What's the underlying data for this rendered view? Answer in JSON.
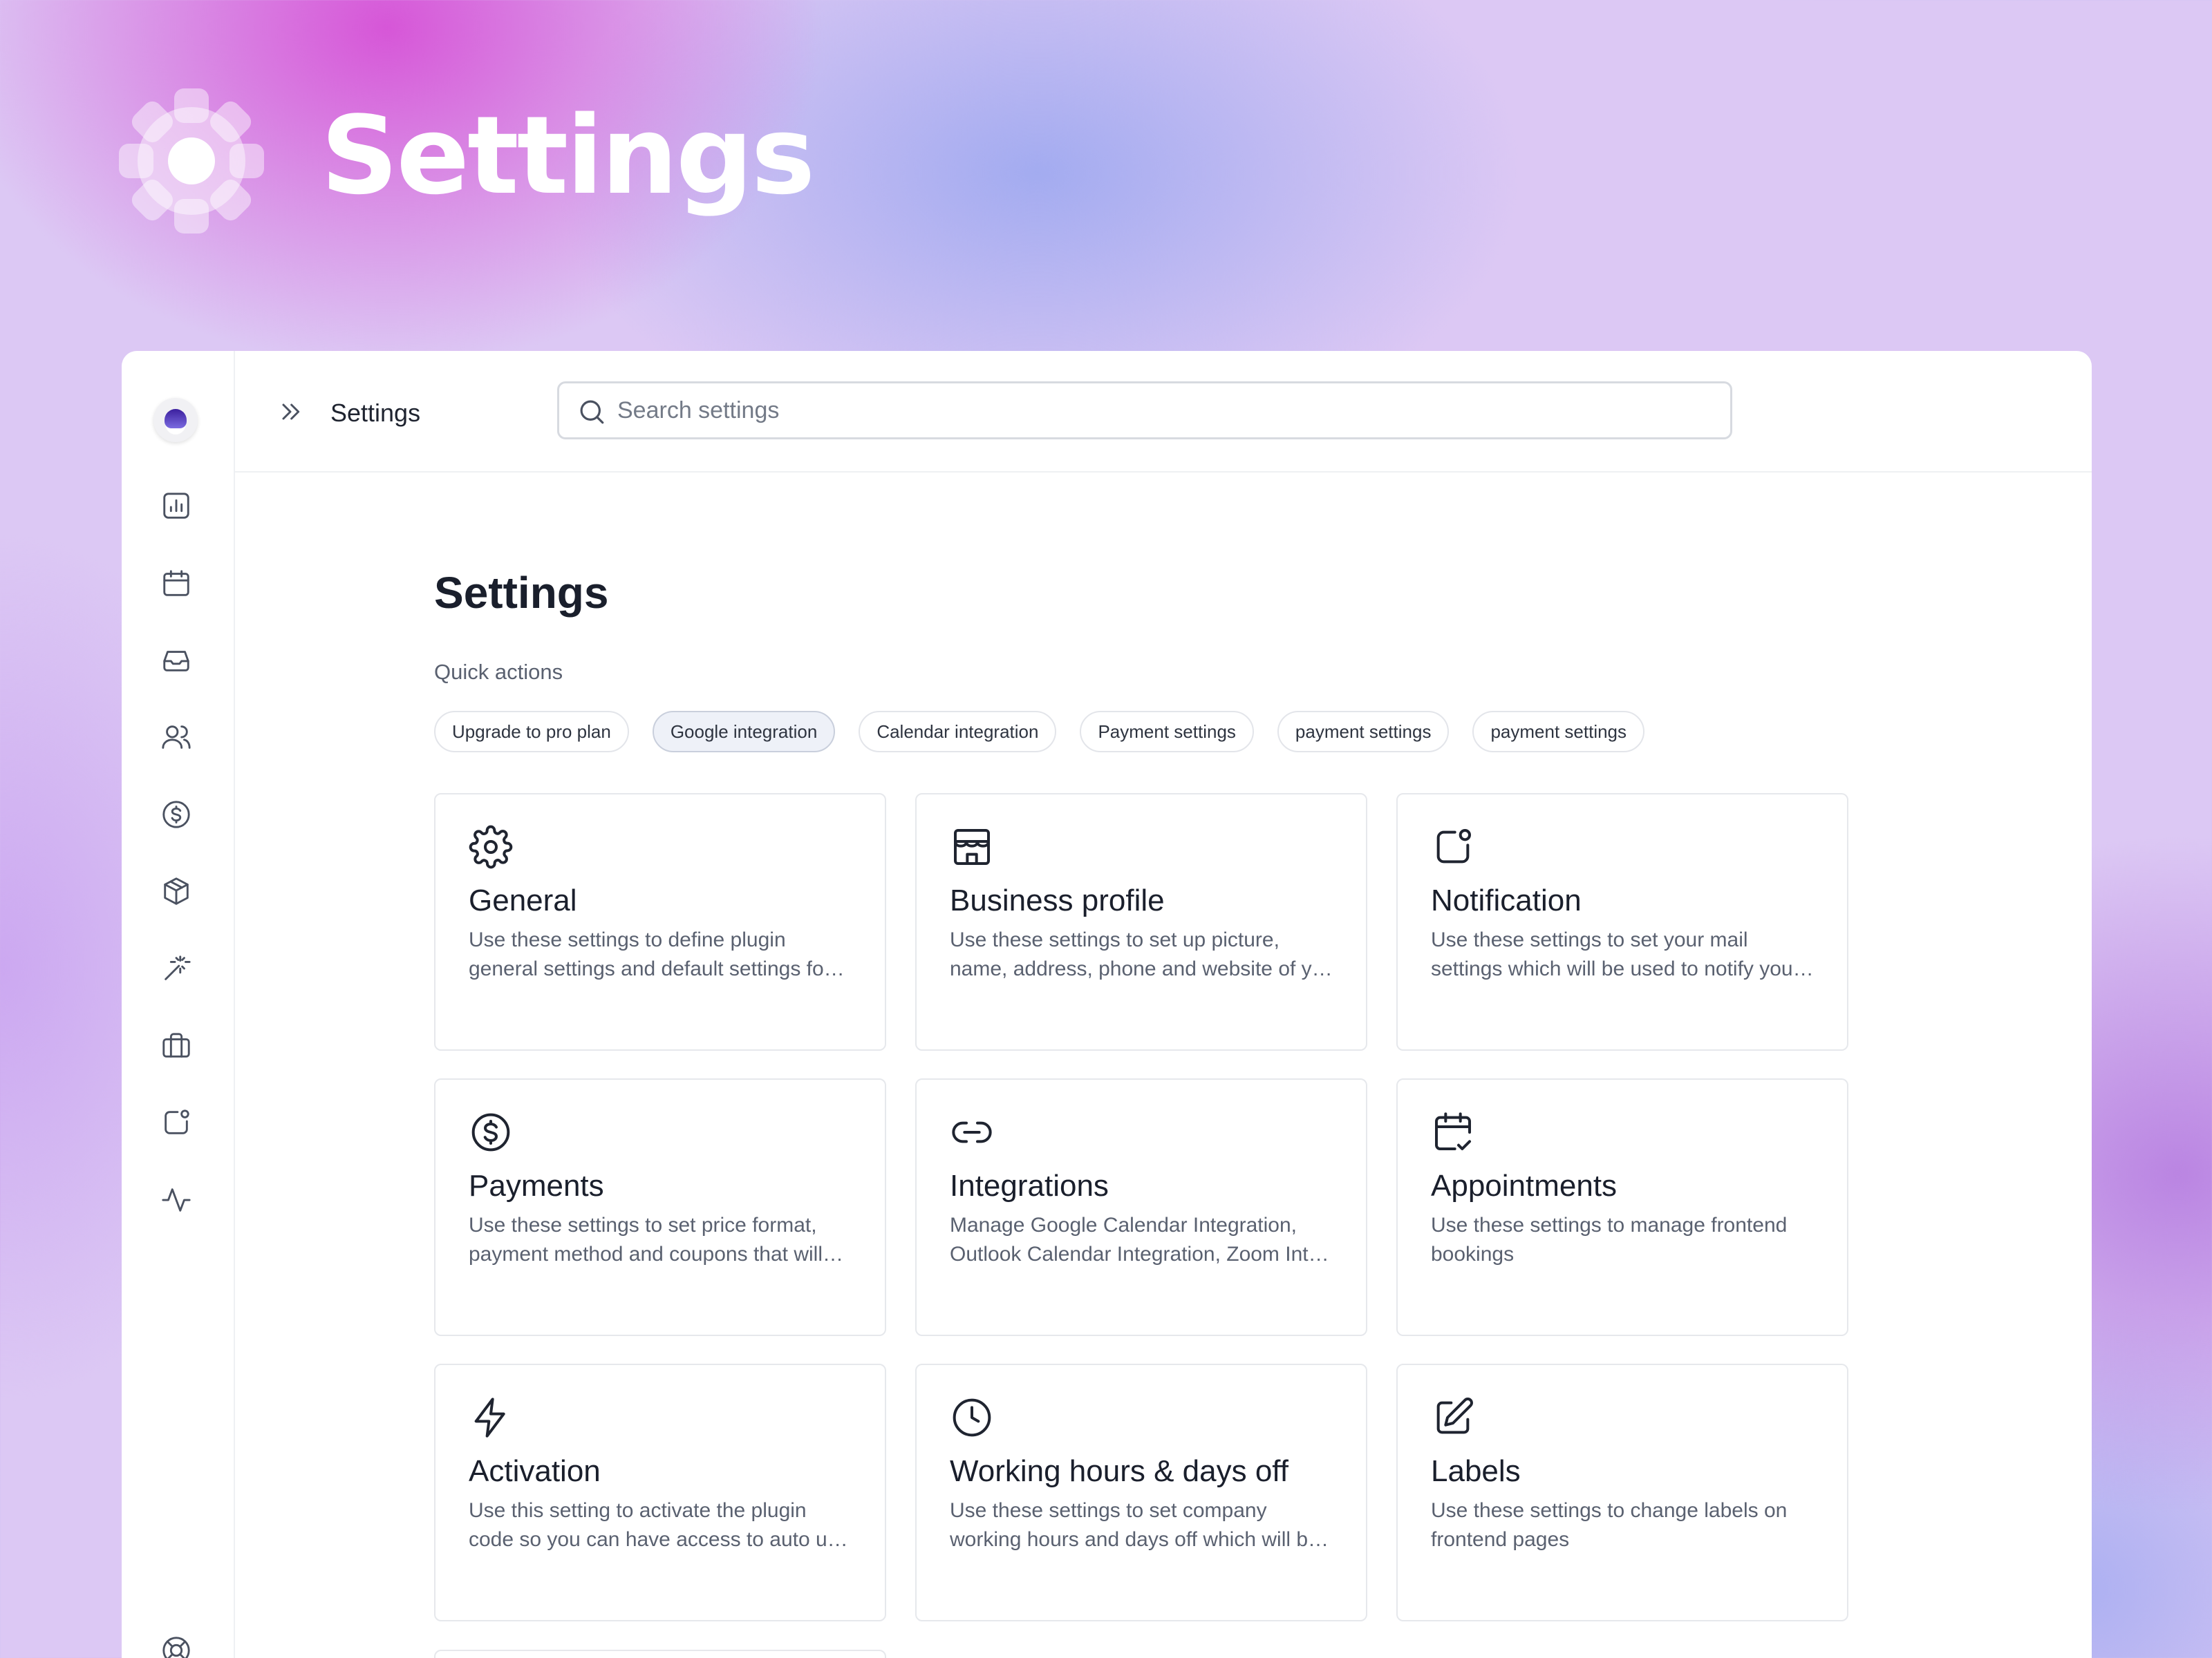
{
  "hero": {
    "title": "Settings",
    "icon": "gear-icon"
  },
  "sidebar": {
    "items": [
      {
        "name": "reports",
        "icon": "bar-chart-icon"
      },
      {
        "name": "calendar",
        "icon": "calendar-icon"
      },
      {
        "name": "inbox",
        "icon": "inbox-icon"
      },
      {
        "name": "customers",
        "icon": "users-icon"
      },
      {
        "name": "payments",
        "icon": "dollar-icon"
      },
      {
        "name": "products",
        "icon": "box-icon"
      },
      {
        "name": "magic",
        "icon": "wand-icon"
      },
      {
        "name": "services",
        "icon": "briefcase-icon"
      },
      {
        "name": "notifications",
        "icon": "notification-icon"
      },
      {
        "name": "activity",
        "icon": "activity-icon"
      },
      {
        "name": "support",
        "icon": "lifebuoy-icon"
      }
    ]
  },
  "topbar": {
    "title": "Settings",
    "search": {
      "placeholder": "Search settings",
      "value": ""
    }
  },
  "main": {
    "title": "Settings",
    "quick_actions_label": "Quick actions",
    "quick_actions": [
      {
        "label": "Upgrade to pro plan",
        "active": false
      },
      {
        "label": "Google integration",
        "active": true
      },
      {
        "label": "Calendar integration",
        "active": false
      },
      {
        "label": "Payment settings",
        "active": false
      },
      {
        "label": "payment settings",
        "active": false
      },
      {
        "label": "payment settings",
        "active": false
      }
    ],
    "cards": [
      {
        "icon": "gear-icon",
        "title": "General",
        "description": "Use these settings to define plugin general settings and default settings fo…"
      },
      {
        "icon": "store-icon",
        "title": "Business profile",
        "description": "Use these settings to set up picture, name, address, phone and website of y…"
      },
      {
        "icon": "notification-icon",
        "title": "Notification",
        "description": "Use these settings to set your mail settings which will be used to notify you…"
      },
      {
        "icon": "dollar-icon",
        "title": "Payments",
        "description": "Use these settings to set price format, payment method and coupons that will…"
      },
      {
        "icon": "link-icon",
        "title": "Integrations",
        "description": "Manage Google Calendar Integration, Outlook Calendar Integration, Zoom Int…"
      },
      {
        "icon": "calendar-check-icon",
        "title": "Appointments",
        "description": "Use these settings to manage frontend bookings"
      },
      {
        "icon": "lightning-icon",
        "title": "Activation",
        "description": "Use this setting to activate the plugin code so you can have access to auto u…"
      },
      {
        "icon": "clock-icon",
        "title": "Working hours & days off",
        "description": "Use these settings to set company working hours and days off which will b…"
      },
      {
        "icon": "edit-icon",
        "title": "Labels",
        "description": "Use these settings to change labels on frontend pages"
      }
    ]
  }
}
